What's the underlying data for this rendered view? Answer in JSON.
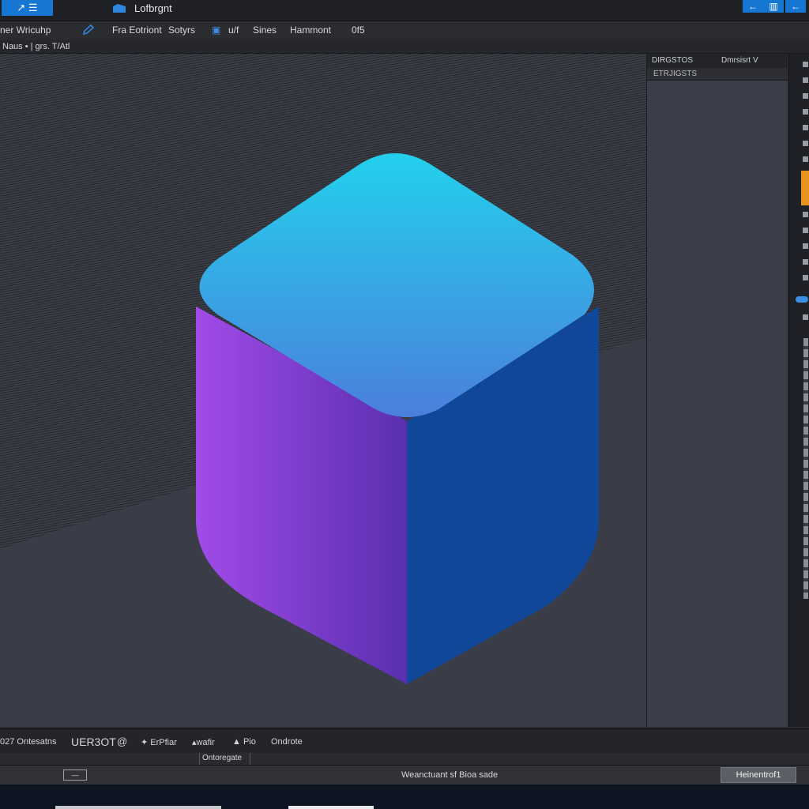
{
  "titlebar": {
    "title": "Lofbrgnt",
    "app_button_label": "↗ ☰"
  },
  "window_buttons": [
    "←",
    "▥",
    "←"
  ],
  "menu": {
    "items": [
      "ner Wricuhp",
      "Fra Eotriont",
      "Sotyrs",
      "u/f",
      "Sines",
      "Hammont",
      "0f5"
    ],
    "layer_indicator": "▣"
  },
  "subbar": {
    "text": "Naus • | grs. T/Atl"
  },
  "right_panel": {
    "header_left": "DIRGSTOS",
    "header_right": "Dmrsisrt V",
    "subheader": "ETRJIGSTS"
  },
  "object": {
    "top_color_start": "#23d0ec",
    "top_color_end": "#4b7fdc",
    "left_color_start": "#a14be8",
    "left_color_end": "#5a2fb0",
    "right_color": "#114799"
  },
  "bottom_toolbar": {
    "items": [
      "027 Ontesatns",
      "UER3OT",
      "@",
      "✦ ErPfiar",
      "▴wafir",
      "▲ Pio",
      "Ondrote"
    ]
  },
  "bottom_bar2": {
    "label": "Ontoregate"
  },
  "statusbar": {
    "box_label": "—",
    "center_text": "Weanctuant sf Bioa sade",
    "button_label": "Heinentrof1"
  }
}
